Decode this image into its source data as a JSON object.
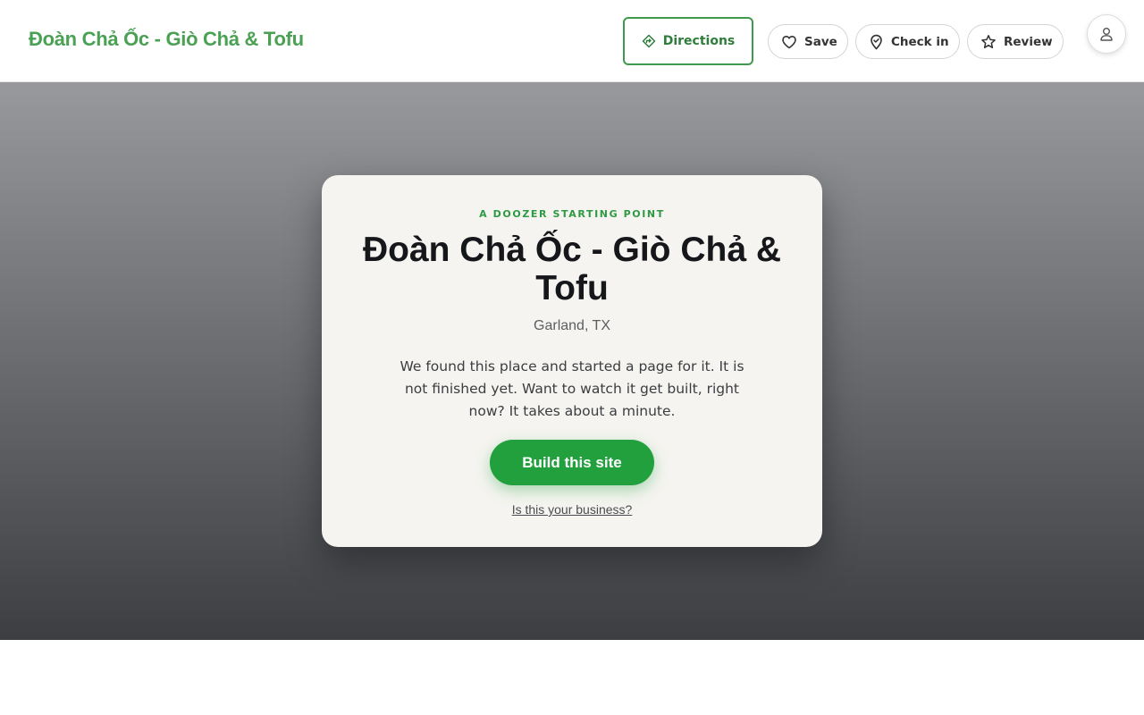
{
  "header": {
    "brand": "Đoàn Chả Ốc - Giò Chả & Tofu",
    "actions": {
      "directions": {
        "label": "Directions",
        "icon": "directions-icon"
      },
      "save": {
        "label": "Save",
        "icon": "heart-icon"
      },
      "checkin": {
        "label": "Check in",
        "icon": "map-pin-icon"
      },
      "review": {
        "label": "Review",
        "icon": "star-icon"
      }
    },
    "account_icon": "user-icon"
  },
  "hero": {
    "eyebrow": "A DOOZER STARTING POINT",
    "title": "Đoàn Chả Ốc - Giò Chả & Tofu",
    "location": "Garland, TX",
    "description": "We found this place and started a page for it. It is not finished yet. Want to watch it get built, right now? It takes about a minute.",
    "cta_label": "Build this site",
    "claim_link": "Is this your business?"
  },
  "colors": {
    "brand_green": "#4aa154",
    "cta_green": "#22a03e",
    "card_bg": "#f5f4f0"
  }
}
